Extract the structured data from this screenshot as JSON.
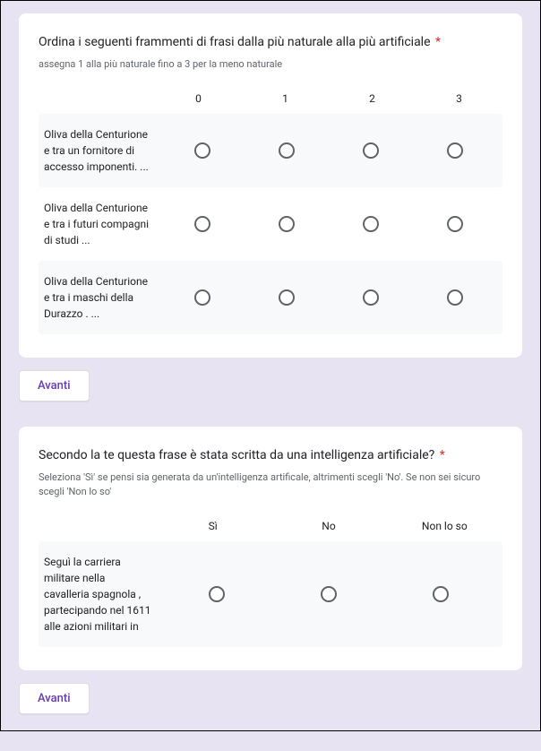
{
  "q1": {
    "title": "Ordina i seguenti frammenti di frasi dalla più naturale alla più artificiale",
    "required_mark": "*",
    "description": "assegna 1 alla più naturale fino a 3 per la meno naturale",
    "columns": [
      "0",
      "1",
      "2",
      "3"
    ],
    "rows": [
      {
        "label": "Oliva della Centurione e tra un fornitore di accesso imponenti. ..."
      },
      {
        "label": "Oliva della Centurione e tra i futuri compagni di studi ..."
      },
      {
        "label": "Oliva della Centurione e tra i maschi della Durazzo . ..."
      }
    ]
  },
  "nav1": {
    "next": "Avanti"
  },
  "q2": {
    "title": "Secondo la te questa frase è stata scritta da una intelligenza artificiale?",
    "required_mark": "*",
    "description": "Seleziona 'Sì' se pensi sia generata da un'intelligenza artificale, altrimenti scegli 'No'. Se non sei sicuro scegli 'Non lo so'",
    "columns": [
      "Sì",
      "No",
      "Non lo so"
    ],
    "rows": [
      {
        "label": "Seguì la carriera militare nella cavalleria spagnola , partecipando nel 1611 alle azioni militari in"
      }
    ]
  },
  "nav2": {
    "next": "Avanti"
  }
}
